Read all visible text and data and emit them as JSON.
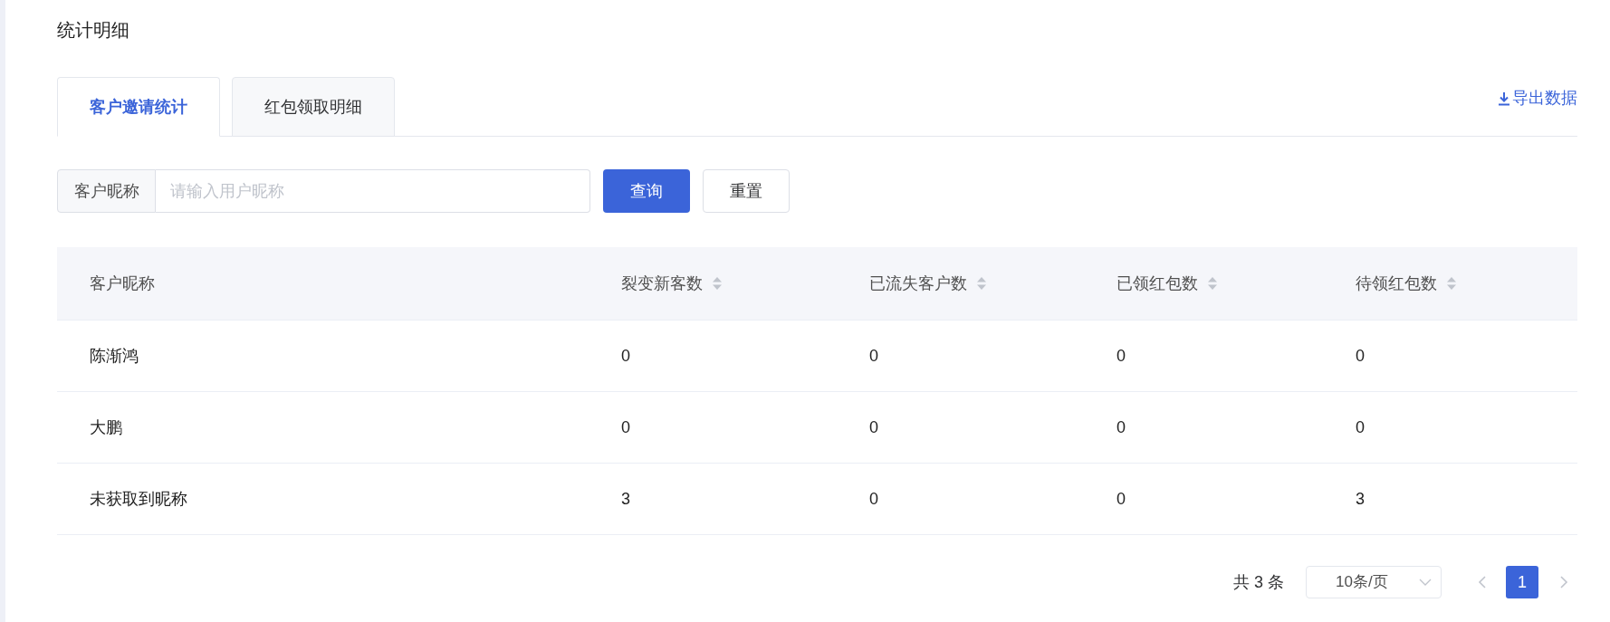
{
  "title": "统计明细",
  "tabs": [
    {
      "label": "客户邀请统计",
      "selected": true
    },
    {
      "label": "红包领取明细",
      "selected": false
    }
  ],
  "export_link": "导出数据",
  "search": {
    "label": "客户昵称",
    "placeholder": "请输入用户昵称"
  },
  "buttons": [
    {
      "label": "查询",
      "kind": "primary"
    },
    {
      "label": "重置",
      "kind": "default"
    }
  ],
  "table": {
    "columns": [
      {
        "label": "客户昵称",
        "sortable": false
      },
      {
        "label": "裂变新客数",
        "sortable": true
      },
      {
        "label": "已流失客户数",
        "sortable": true
      },
      {
        "label": "已领红包数",
        "sortable": true
      },
      {
        "label": "待领红包数",
        "sortable": true
      }
    ],
    "rows": [
      [
        "陈渐鸿",
        "0",
        "0",
        "0",
        "0"
      ],
      [
        "大鹏",
        "0",
        "0",
        "0",
        "0"
      ],
      [
        "未获取到昵称",
        "3",
        "0",
        "0",
        "3"
      ]
    ]
  },
  "pagination": {
    "total": "共 3 条",
    "page_size": "10条/页",
    "pages": [
      {
        "label": "1",
        "selected": true
      }
    ]
  }
}
